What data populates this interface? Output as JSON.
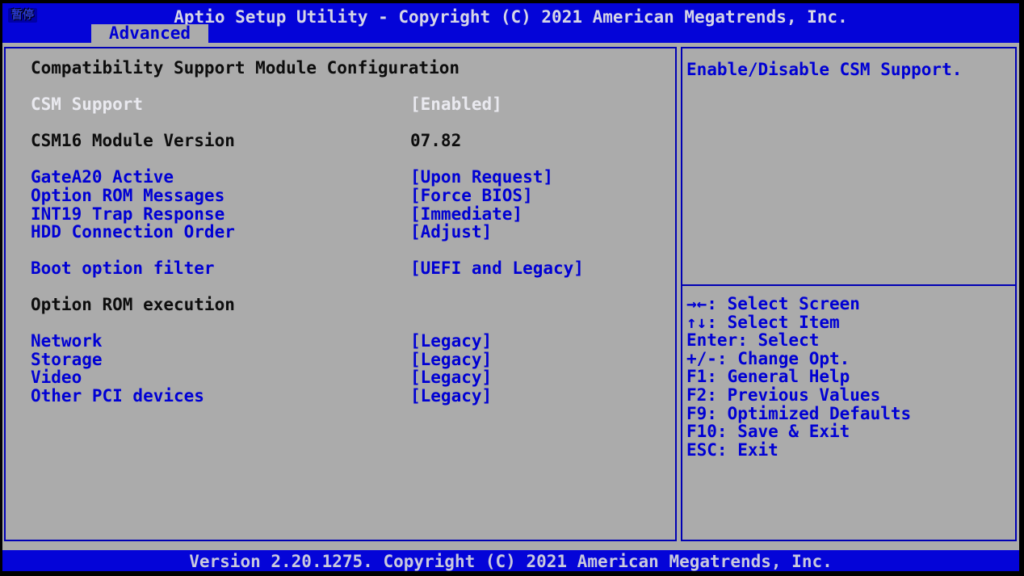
{
  "header": {
    "title": "Aptio Setup Utility - Copyright (C) 2021 American Megatrends, Inc.",
    "pause_badge": "暂停",
    "tab": "Advanced"
  },
  "main": {
    "rows": [
      {
        "label": "Compatibility Support Module Configuration",
        "value": ""
      },
      {
        "label": "CSM Support",
        "value": "[Enabled]"
      },
      {
        "label": "CSM16 Module Version",
        "value": "07.82"
      },
      {
        "label": "GateA20 Active",
        "value": "[Upon Request]"
      },
      {
        "label": "Option ROM Messages",
        "value": "[Force BIOS]"
      },
      {
        "label": "INT19 Trap Response",
        "value": "[Immediate]"
      },
      {
        "label": "HDD Connection Order",
        "value": "[Adjust]"
      },
      {
        "label": "Boot option filter",
        "value": "[UEFI and Legacy]"
      },
      {
        "label": "Option ROM execution",
        "value": ""
      },
      {
        "label": "Network",
        "value": "[Legacy]"
      },
      {
        "label": "Storage",
        "value": "[Legacy]"
      },
      {
        "label": "Video",
        "value": "[Legacy]"
      },
      {
        "label": "Other PCI devices",
        "value": "[Legacy]"
      }
    ]
  },
  "help": {
    "text": "Enable/Disable CSM Support."
  },
  "legend": [
    {
      "text": "→←: Select Screen"
    },
    {
      "text": "↑↓: Select Item"
    },
    {
      "text": "Enter: Select"
    },
    {
      "text": "+/-: Change Opt."
    },
    {
      "text": "F1: General Help"
    },
    {
      "text": "F2: Previous Values"
    },
    {
      "text": "F9: Optimized Defaults"
    },
    {
      "text": "F10: Save & Exit"
    },
    {
      "text": "ESC: Exit"
    }
  ],
  "footer": {
    "text": "Version 2.20.1275. Copyright (C) 2021 American Megatrends, Inc."
  },
  "colors": {
    "bar_blue": "#0404d8",
    "body_gray": "#ababab",
    "border_blue": "#0000b4",
    "text_blue": "#0000d4",
    "selected_white": "#e9e9ef",
    "text_black": "#0d0d0d"
  }
}
